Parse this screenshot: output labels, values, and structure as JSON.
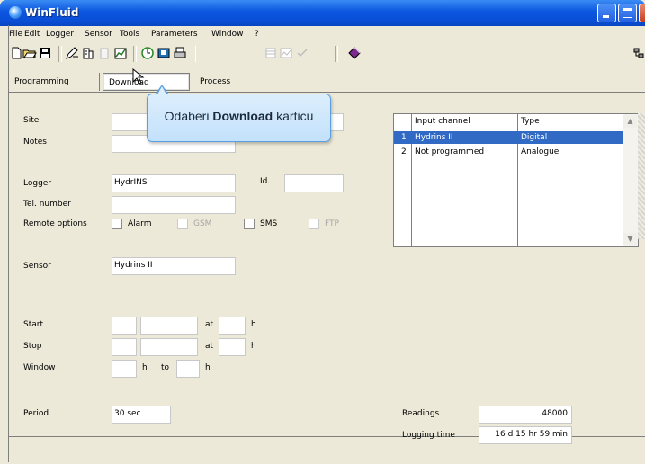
{
  "window": {
    "title": "WinFluid"
  },
  "menu": [
    "File",
    "Edit",
    "Logger",
    "Sensor",
    "Tools",
    "Parameters",
    "Window",
    "?"
  ],
  "tabs": [
    "Programming",
    "Download",
    "Process"
  ],
  "tooltip": {
    "prefix": "Odaberi ",
    "bold": "Download",
    "suffix": " karticu"
  },
  "form": {
    "site_label": "Site",
    "notes_label": "Notes",
    "logger_label": "Logger",
    "logger_value": "HydrINS",
    "id_label": "Id.",
    "tel_label": "Tel. number",
    "remote_label": "Remote options",
    "alarm_label": "Alarm",
    "gsm_label": "GSM",
    "sms_label": "SMS",
    "ftp_label": "FTP",
    "sensor_label": "Sensor",
    "sensor_value": "Hydrins II",
    "start_label": "Start",
    "stop_label": "Stop",
    "window_label": "Window",
    "at_label": "at",
    "h_label": "h",
    "to_label": "to",
    "period_label": "Period",
    "period_value": "30 sec",
    "readings_label": "Readings",
    "readings_value": "48000",
    "logging_time_label": "Logging time",
    "logging_time_value": "16 d 15 hr 59 min"
  },
  "channels": {
    "headers": [
      "Input channel",
      "Type"
    ],
    "rows": [
      {
        "num": "1",
        "channel": "Hydrins II",
        "type": "Digital"
      },
      {
        "num": "2",
        "channel": "Not programmed",
        "type": "Analogue"
      }
    ]
  }
}
